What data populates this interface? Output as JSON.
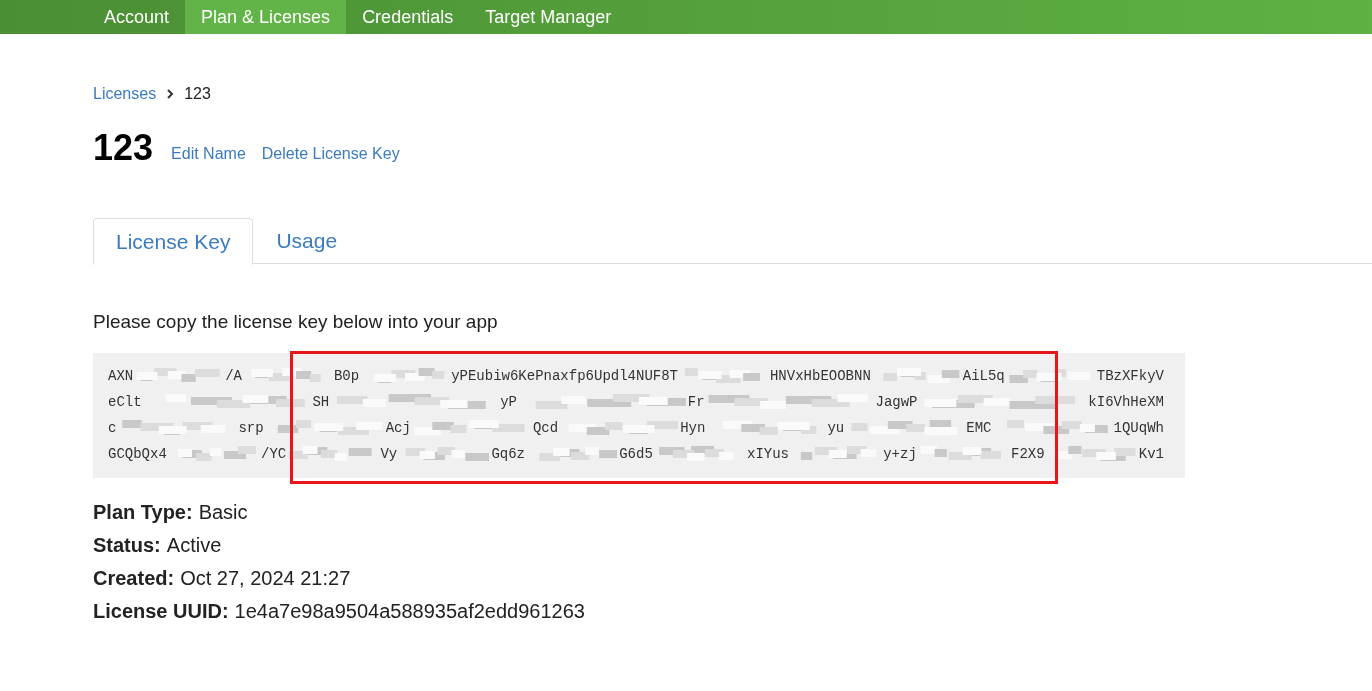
{
  "nav": [
    {
      "label": "Account",
      "selected": false
    },
    {
      "label": "Plan & Licenses",
      "selected": true
    },
    {
      "label": "Credentials",
      "selected": false
    },
    {
      "label": "Target Manager",
      "selected": false
    }
  ],
  "breadcrumb": {
    "link": "Licenses",
    "current": "123"
  },
  "title": "123",
  "actions": [
    "Edit Name",
    "Delete License Key"
  ],
  "tabs": [
    {
      "label": "License Key",
      "selected": true
    },
    {
      "label": "Usage",
      "selected": false
    }
  ],
  "instruction": "Please copy the license key below into your app",
  "license_key_lines": [
    [
      "AXN",
      "/A",
      "B0p",
      "yPEubiw6KePnaxfp6Updl4NUF8T",
      "HNVxHbEOOBNN",
      "AiL5q",
      "TBzXFkyV"
    ],
    [
      "eClt",
      "SH",
      "yP",
      "Fr",
      "JagwP",
      "kI6VhHeXM"
    ],
    [
      "c",
      "srp",
      "Acj",
      "Qcd",
      "Hyn",
      "yu",
      "EMC",
      "1QUqWh"
    ],
    [
      "GCQbQx4",
      "/YC",
      "Vy",
      "Gq6z",
      "G6d5",
      "xIYus",
      "y+zj",
      "F2X9",
      "Kv1"
    ]
  ],
  "annotation": {
    "highlighted": true
  },
  "details": [
    {
      "label": "Plan Type:",
      "value": "Basic"
    },
    {
      "label": "Status:",
      "value": "Active"
    },
    {
      "label": "Created:",
      "value": "Oct 27, 2024 21:27"
    },
    {
      "label": "License UUID:",
      "value": "1e4a7e98a9504a588935af2edd961263"
    }
  ]
}
